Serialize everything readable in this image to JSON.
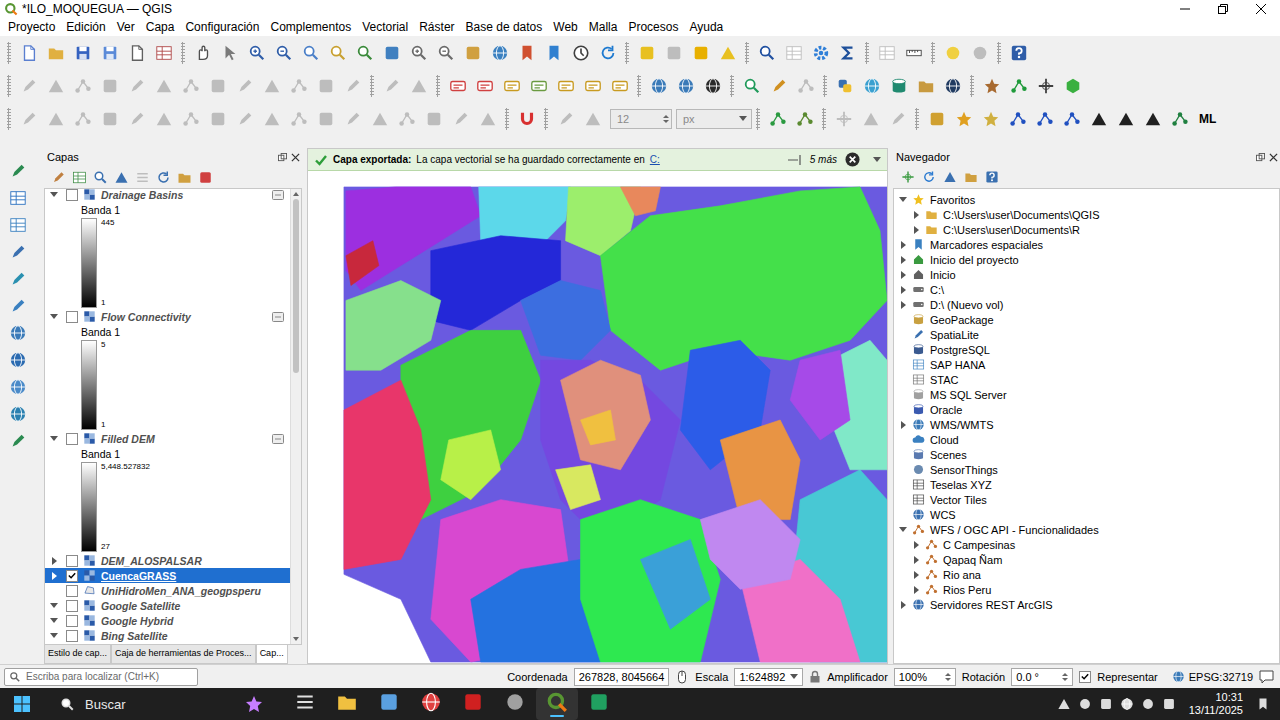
{
  "window": {
    "title": "*ILO_MOQUEGUA — QGIS"
  },
  "menu": [
    "Proyecto",
    "Edición",
    "Ver",
    "Capa",
    "Configuración",
    "Complementos",
    "Vectorial",
    "Ráster",
    "Base de datos",
    "Web",
    "Malla",
    "Procesos",
    "Ayuda"
  ],
  "toolbars": [
    [
      {
        "kind": "icons",
        "buttons": [
          {
            "disabled": false
          },
          {
            "disabled": false
          },
          {
            "disabled": false
          },
          {
            "disabled": false
          },
          {
            "disabled": false
          },
          {
            "disabled": false
          }
        ]
      },
      {
        "kind": "icons",
        "buttons": [
          {
            "disabled": false
          },
          {
            "disabled": false
          },
          {
            "disabled": false
          },
          {
            "disabled": false
          },
          {
            "disabled": false
          },
          {
            "disabled": false
          },
          {
            "disabled": false
          },
          {
            "disabled": false
          },
          {
            "disabled": false
          },
          {
            "disabled": false
          },
          {
            "disabled": false
          },
          {
            "disabled": false
          },
          {
            "disabled": false
          },
          {
            "disabled": false
          },
          {
            "disabled": false
          },
          {
            "disabled": false
          }
        ]
      },
      {
        "kind": "icons",
        "buttons": [
          {
            "disabled": false
          },
          {
            "disabled": true
          },
          {
            "disabled": false
          },
          {
            "disabled": false
          }
        ]
      },
      {
        "kind": "icons",
        "buttons": [
          {
            "disabled": false
          },
          {
            "disabled": true
          },
          {
            "disabled": false
          },
          {
            "disabled": false
          }
        ]
      },
      {
        "kind": "icons",
        "buttons": [
          {
            "disabled": true
          },
          {
            "disabled": false
          }
        ]
      },
      {
        "kind": "icons",
        "buttons": [
          {
            "disabled": false
          },
          {
            "disabled": true
          }
        ]
      },
      {
        "kind": "icons",
        "buttons": [
          {
            "disabled": false
          }
        ]
      }
    ],
    [
      {
        "kind": "icons",
        "buttons": [
          {
            "disabled": true
          },
          {
            "disabled": true
          },
          {
            "disabled": true
          },
          {
            "disabled": true
          },
          {
            "disabled": true
          },
          {
            "disabled": true
          },
          {
            "disabled": true
          },
          {
            "disabled": true
          },
          {
            "disabled": true
          },
          {
            "disabled": true
          },
          {
            "disabled": true
          },
          {
            "disabled": true
          },
          {
            "disabled": true
          }
        ]
      },
      {
        "kind": "icons",
        "buttons": [
          {
            "disabled": true
          },
          {
            "disabled": true
          }
        ]
      },
      {
        "kind": "icons",
        "buttons": [
          {
            "disabled": false
          },
          {
            "disabled": false
          },
          {
            "disabled": false
          },
          {
            "disabled": false
          },
          {
            "disabled": false
          },
          {
            "disabled": false
          },
          {
            "disabled": false
          }
        ]
      },
      {
        "kind": "icons",
        "buttons": [
          {
            "disabled": false
          },
          {
            "disabled": false
          },
          {
            "disabled": false
          }
        ]
      },
      {
        "kind": "icons",
        "buttons": [
          {
            "disabled": false
          },
          {
            "disabled": false
          },
          {
            "disabled": true
          }
        ]
      },
      {
        "kind": "icons",
        "buttons": [
          {
            "disabled": false
          },
          {
            "disabled": false
          },
          {
            "disabled": false
          },
          {
            "disabled": false
          },
          {
            "disabled": false
          }
        ]
      },
      {
        "kind": "icons",
        "buttons": [
          {
            "disabled": false
          },
          {
            "disabled": false
          },
          {
            "disabled": false
          },
          {
            "disabled": false
          }
        ]
      }
    ],
    [
      {
        "kind": "icons",
        "buttons": [
          {
            "disabled": true
          },
          {
            "disabled": true
          },
          {
            "disabled": true
          },
          {
            "disabled": true
          },
          {
            "disabled": true
          },
          {
            "disabled": true
          },
          {
            "disabled": true
          },
          {
            "disabled": true
          },
          {
            "disabled": true
          },
          {
            "disabled": true
          },
          {
            "disabled": true
          },
          {
            "disabled": true
          },
          {
            "disabled": true
          },
          {
            "disabled": true
          },
          {
            "disabled": true
          },
          {
            "disabled": true
          },
          {
            "disabled": true
          },
          {
            "disabled": true
          }
        ]
      },
      {
        "kind": "icons",
        "buttons": [
          {
            "disabled": false
          }
        ]
      },
      {
        "kind": "icons",
        "buttons": [
          {
            "disabled": true
          },
          {
            "disabled": true
          }
        ]
      },
      {
        "kind": "field",
        "value": "12",
        "unit": "px",
        "disabled": true
      },
      {
        "kind": "icons",
        "buttons": [
          {
            "disabled": false
          },
          {
            "disabled": false
          }
        ]
      },
      {
        "kind": "icons",
        "buttons": [
          {
            "disabled": true
          },
          {
            "disabled": true
          },
          {
            "disabled": true
          }
        ]
      },
      {
        "kind": "icons",
        "buttons": [
          {
            "disabled": false
          },
          {
            "disabled": false
          },
          {
            "disabled": false
          },
          {
            "disabled": false
          },
          {
            "disabled": false
          },
          {
            "disabled": false
          },
          {
            "disabled": false
          },
          {
            "disabled": false
          },
          {
            "disabled": false
          },
          {
            "disabled": false
          }
        ]
      },
      {
        "kind": "text",
        "text": "ML"
      }
    ]
  ],
  "side_toolbar": [
    {
      "disabled": false
    },
    {
      "disabled": false
    },
    {
      "disabled": false
    },
    {
      "disabled": false
    },
    {
      "disabled": false
    },
    {
      "disabled": false
    },
    {
      "disabled": false
    },
    {
      "disabled": false
    },
    {
      "disabled": false
    },
    {
      "disabled": false
    },
    {
      "disabled": false
    }
  ],
  "layers_panel": {
    "title": "Capas",
    "toolbar": [
      {
        "disabled": false
      },
      {
        "disabled": false
      },
      {
        "disabled": false
      },
      {
        "disabled": false
      },
      {
        "disabled": true
      },
      {
        "disabled": false
      },
      {
        "disabled": false
      },
      {
        "disabled": false
      }
    ],
    "scrollbar": {
      "level": 0.4
    },
    "layers": [
      {
        "name": "Drainage Basins",
        "kind": "raster",
        "expandable": true,
        "expanded": true,
        "checked": false,
        "selected": false,
        "indicator": true,
        "legend": {
          "band": "Banda 1",
          "max": "445",
          "min": "1"
        }
      },
      {
        "name": "Flow Connectivity",
        "kind": "raster",
        "expandable": true,
        "expanded": true,
        "checked": false,
        "selected": false,
        "indicator": true,
        "legend": {
          "band": "Banda 1",
          "max": "5",
          "min": "1"
        }
      },
      {
        "name": "Filled DEM",
        "kind": "raster",
        "expandable": true,
        "expanded": true,
        "checked": false,
        "selected": false,
        "indicator": true,
        "legend": {
          "band": "Banda 1",
          "max": "5,448.527832",
          "min": "27"
        }
      },
      {
        "name": "DEM_ALOSPALSAR",
        "kind": "raster",
        "expandable": true,
        "expanded": false,
        "checked": false,
        "selected": false,
        "indicator": false
      },
      {
        "name": "CuencaGRASS",
        "kind": "raster",
        "expandable": true,
        "expanded": false,
        "checked": true,
        "selected": true,
        "indicator": false
      },
      {
        "name": "UniHidroMen_ANA_geogpsperu",
        "kind": "vector",
        "expandable": false,
        "expanded": false,
        "checked": false,
        "selected": false,
        "indicator": false
      },
      {
        "name": "Google Satellite",
        "kind": "raster",
        "expandable": true,
        "expanded": true,
        "checked": false,
        "selected": false,
        "indicator": false
      },
      {
        "name": "Google Hybrid",
        "kind": "raster",
        "expandable": true,
        "expanded": true,
        "checked": false,
        "selected": false,
        "indicator": false
      },
      {
        "name": "Bing Satellite",
        "kind": "raster",
        "expandable": true,
        "expanded": true,
        "checked": false,
        "selected": false,
        "indicator": false
      }
    ],
    "tabs": [
      {
        "label": "Estilo de cap...",
        "selected": false
      },
      {
        "label": "Caja de herramientas de Proces...",
        "selected": false
      },
      {
        "label": "Cap...",
        "selected": true
      }
    ]
  },
  "message_bar": {
    "title": "Capa exportada:",
    "text": "La capa vectorial se ha guardado correctamente en",
    "link": "C:",
    "more": "5 más"
  },
  "map": {
    "regions": [
      {
        "color": "#6a5ae0"
      },
      {
        "color": "#9c2fe0"
      },
      {
        "color": "#c8283c"
      },
      {
        "color": "#5cd8ea"
      },
      {
        "color": "#9cee6c"
      },
      {
        "color": "#e8885c"
      },
      {
        "color": "#44e04a"
      },
      {
        "color": "#2428d8"
      },
      {
        "color": "#3c6ee0"
      },
      {
        "color": "#86e08c"
      },
      {
        "color": "#3ed040"
      },
      {
        "color": "#e8366a"
      },
      {
        "color": "#7448e0"
      },
      {
        "color": "#e0907c"
      },
      {
        "color": "#b8f048"
      },
      {
        "color": "#d848d0"
      },
      {
        "color": "#2472e0"
      },
      {
        "color": "#2ee850"
      },
      {
        "color": "#2c5ce8"
      },
      {
        "color": "#e89444"
      },
      {
        "color": "#48c8d4"
      },
      {
        "color": "#f070c8"
      },
      {
        "color": "#80e8c8"
      },
      {
        "color": "#a64ae8"
      },
      {
        "color": "#c088f0"
      },
      {
        "color": "#d8e860"
      },
      {
        "color": "#3aa0d8"
      },
      {
        "color": "#f0c040"
      }
    ]
  },
  "navigator": {
    "title": "Navegador",
    "toolbar": [
      {
        "disabled": false
      },
      {
        "disabled": false
      },
      {
        "disabled": false
      },
      {
        "disabled": false
      },
      {
        "disabled": false
      }
    ],
    "items": [
      {
        "label": "Favoritos",
        "expandable": true,
        "expanded": true,
        "children": [
          {
            "label": "C:\\Users\\user\\Documents\\QGIS",
            "expandable": true,
            "expanded": false
          },
          {
            "label": "C:\\Users\\user\\Documents\\R",
            "expandable": true,
            "expanded": false
          }
        ]
      },
      {
        "label": "Marcadores espaciales",
        "expandable": true,
        "expanded": false
      },
      {
        "label": "Inicio del proyecto",
        "expandable": true,
        "expanded": false
      },
      {
        "label": "Inicio",
        "expandable": true,
        "expanded": false
      },
      {
        "label": "C:\\",
        "expandable": true,
        "expanded": false
      },
      {
        "label": "D:\\ (Nuevo vol)",
        "expandable": true,
        "expanded": false
      },
      {
        "label": "GeoPackage",
        "expandable": false,
        "expanded": false
      },
      {
        "label": "SpatiaLite",
        "expandable": false,
        "expanded": false
      },
      {
        "label": "PostgreSQL",
        "expandable": false,
        "expanded": false
      },
      {
        "label": "SAP HANA",
        "expandable": false,
        "expanded": false
      },
      {
        "label": "STAC",
        "expandable": false,
        "expanded": false
      },
      {
        "label": "MS SQL Server",
        "expandable": false,
        "expanded": false
      },
      {
        "label": "Oracle",
        "expandable": false,
        "expanded": false
      },
      {
        "label": "WMS/WMTS",
        "expandable": true,
        "expanded": false
      },
      {
        "label": "Cloud",
        "expandable": false,
        "expanded": false
      },
      {
        "label": "Scenes",
        "expandable": false,
        "expanded": false
      },
      {
        "label": "SensorThings",
        "expandable": false,
        "expanded": false
      },
      {
        "label": "Teselas XYZ",
        "expandable": false,
        "expanded": false
      },
      {
        "label": "Vector Tiles",
        "expandable": false,
        "expanded": false
      },
      {
        "label": "WCS",
        "expandable": false,
        "expanded": false
      },
      {
        "label": "WFS / OGC API - Funcionalidades",
        "expandable": true,
        "expanded": true,
        "children": [
          {
            "label": "C Campesinas",
            "expandable": true,
            "expanded": false
          },
          {
            "label": "Qapaq Ñam",
            "expandable": true,
            "expanded": false
          },
          {
            "label": "Rio ana",
            "expandable": true,
            "expanded": false
          },
          {
            "label": "Rios Peru",
            "expandable": true,
            "expanded": false
          }
        ]
      },
      {
        "label": "Servidores REST ArcGIS",
        "expandable": true,
        "expanded": false
      }
    ]
  },
  "status_bar": {
    "search_placeholder": "Escriba para localizar (Ctrl+K)",
    "coordinate_label": "Coordenada",
    "coordinate": "267828, 8045664",
    "scale_label": "Escala",
    "scale": "1:624892",
    "magnifier_label": "Amplificador",
    "magnifier": "100%",
    "rotation_label": "Rotación",
    "rotation": "0.0 °",
    "render_label": "Representar",
    "render_checked": true,
    "crs": "EPSG:32719"
  },
  "taskbar": {
    "search": "Buscar",
    "apps": [
      {
        "active": false
      },
      {
        "active": false
      },
      {
        "active": false
      },
      {
        "active": false
      },
      {
        "active": false
      },
      {
        "active": false
      },
      {
        "active": true
      },
      {
        "active": false
      }
    ],
    "time": "10:31",
    "date": "13/11/2025"
  }
}
